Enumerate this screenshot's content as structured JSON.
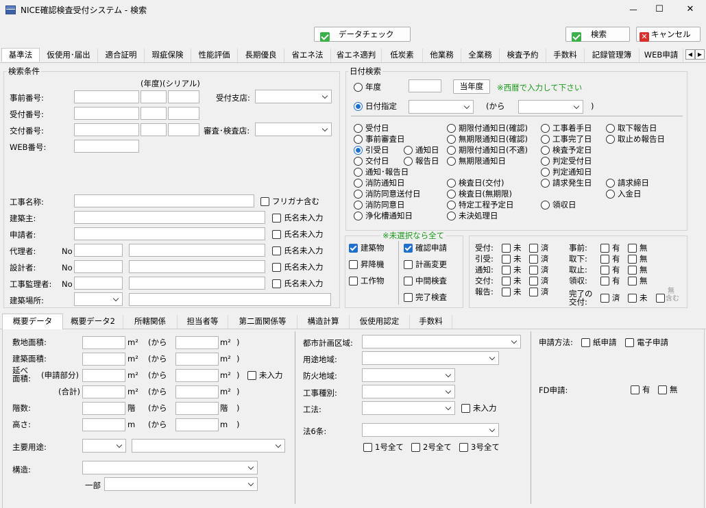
{
  "window": {
    "title": "NICE確認検査受付システム - 検索",
    "minimize": "—",
    "maximize": "☐",
    "close": "✕"
  },
  "toolbar": {
    "data_check": "データチェック",
    "search": "検索",
    "cancel": "キャンセル"
  },
  "top_tabs": [
    "基準法",
    "仮使用･届出",
    "適合証明",
    "瑕疵保険",
    "性能評価",
    "長期優良",
    "省エネ法",
    "省エネ適判",
    "低炭素",
    "他業務",
    "全業務",
    "検査予約",
    "手数料",
    "記録管理簿",
    "WEB申請"
  ],
  "search": {
    "group_title": "検索条件",
    "year_label": "(年度)(シリアル)",
    "jizen": "事前番号:",
    "uketsuke": "受付番号:",
    "kofu": "交付番号:",
    "web": "WEB番号:",
    "uketsuke_shiten": "受付支店:",
    "shinsa_kensa": "審査･検査店:",
    "koji_name": "工事名称:",
    "furigana": "フリガナ含む",
    "kenchikunushi": "建築主:",
    "shinseisha": "申請者:",
    "dairinin": "代理者:",
    "sekkeisha": "設計者:",
    "kanrisha": "工事監理者:",
    "basho": "建築場所:",
    "no": "No",
    "shimei_minyuryoku": "氏名未入力"
  },
  "date_search": {
    "group_title": "日付検索",
    "nendo": "年度",
    "today_btn": "当年度",
    "note": "※西暦で入力して下さい",
    "date_spec": "日付指定",
    "from": "(から",
    "close_paren": ")",
    "radios": [
      {
        "label": "受付日",
        "on": false
      },
      {
        "label": "期限付通知日(確認)",
        "on": false
      },
      {
        "label": "工事着手日",
        "on": false
      },
      {
        "label": "取下報告日",
        "on": false
      },
      {
        "label": "事前審査日",
        "on": false
      },
      {
        "label": "無期限通知日(確認)",
        "on": false
      },
      {
        "label": "工事完了日",
        "on": false
      },
      {
        "label": "取止め報告日",
        "on": false
      },
      {
        "label": "引受日",
        "on": true
      },
      {
        "label": "通知日",
        "on": false
      },
      {
        "label": "期限付通知日(不適)",
        "on": false
      },
      {
        "label": "検査予定日",
        "on": false
      },
      {
        "label": "交付日",
        "on": false
      },
      {
        "label": "報告日",
        "on": false
      },
      {
        "label": "無期限通知日",
        "on": false
      },
      {
        "label": "判定受付日",
        "on": false
      },
      {
        "label": "通知･報告日",
        "on": false
      },
      {
        "label": "判定通知日",
        "on": false
      },
      {
        "label": "消防通知日",
        "on": false
      },
      {
        "label": "検査日(交付)",
        "on": false
      },
      {
        "label": "請求発生日",
        "on": false
      },
      {
        "label": "請求締日",
        "on": false
      },
      {
        "label": "消防同意送付日",
        "on": false
      },
      {
        "label": "検査日(無期限)",
        "on": false
      },
      {
        "label": "入金日",
        "on": false
      },
      {
        "label": "消防同意日",
        "on": false
      },
      {
        "label": "特定工程予定日",
        "on": false
      },
      {
        "label": "領収日",
        "on": false
      },
      {
        "label": "浄化槽通知日",
        "on": false
      },
      {
        "label": "未決処理日",
        "on": false
      }
    ]
  },
  "kind": {
    "note": "※未選択なら全て",
    "items": [
      {
        "label": "建築物",
        "on": true
      },
      {
        "label": "昇降機",
        "on": false
      },
      {
        "label": "工作物",
        "on": false
      }
    ],
    "items2": [
      {
        "label": "確認申請",
        "on": true
      },
      {
        "label": "計画変更",
        "on": false
      },
      {
        "label": "中間検査",
        "on": false
      },
      {
        "label": "完了検査",
        "on": false
      }
    ]
  },
  "status": {
    "rows1": [
      "受付:",
      "引受:",
      "通知:",
      "交付:",
      "報告:"
    ],
    "mi": "未",
    "zumi": "済",
    "rows2": [
      "事前:",
      "取下:",
      "取止:",
      "領収:"
    ],
    "ari": "有",
    "nashi": "無",
    "kanryo_label1": "完了の",
    "kanryo_label2": "交付:",
    "sumi": "済",
    "mi2": "未",
    "mu_fukumu1": "無",
    "mu_fukumu2": "含む"
  },
  "bottom_tabs": [
    "概要データ",
    "概要データ2",
    "所轄関係",
    "担当者等",
    "第二面関係等",
    "構造計算",
    "仮使用認定",
    "手数料"
  ],
  "gaiyo": {
    "shikichi": "敷地面積:",
    "kenchiku": "建築面積:",
    "nobe1": "延べ",
    "nobe2": "面積:",
    "shinsei_bubun": "(申請部分)",
    "gokei": "(合計)",
    "kaisu": "階数:",
    "takasa": "高さ:",
    "shuyoto": "主要用途:",
    "kozo": "構造:",
    "ichibu": "一部",
    "m2": "m²",
    "kai": "階",
    "m": "m",
    "kara": "(から",
    "paren": ")",
    "minyuryoku": "未入力"
  },
  "toshi": {
    "toshi_keikaku": "都市計画区域:",
    "yoto_chiiki": "用途地域:",
    "boka": "防火地域:",
    "koji_shubetsu": "工事種別:",
    "koho": "工法:",
    "minyuryoku": "未入力",
    "ho6": "法6条:",
    "g1": "1号全て",
    "g2": "2号全て",
    "g3": "3号全て"
  },
  "shinsei": {
    "method": "申請方法:",
    "paper": "紙申請",
    "electronic": "電子申請",
    "fd": "FD申請:",
    "ari": "有",
    "nashi": "無"
  }
}
